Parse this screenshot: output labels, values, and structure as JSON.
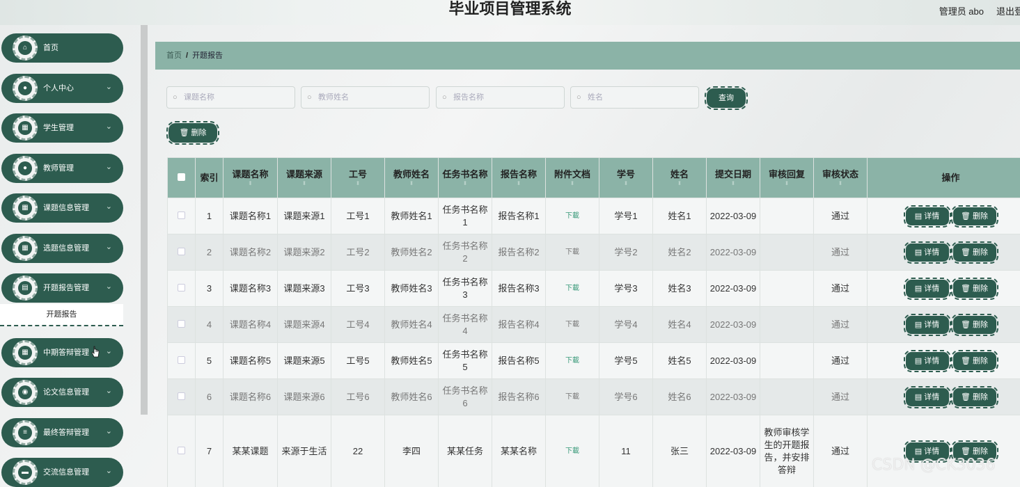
{
  "header": {
    "title": "毕业项目管理系统",
    "user": "管理员 abo",
    "logout": "退出登"
  },
  "sidebar": {
    "items": [
      {
        "label": "首页",
        "icon": "home-icon",
        "glyph": "⌂",
        "chevron": false
      },
      {
        "label": "个人中心",
        "icon": "user-icon",
        "glyph": "●",
        "chevron": true
      },
      {
        "label": "学生管理",
        "icon": "grid-icon",
        "glyph": "▦",
        "chevron": true
      },
      {
        "label": "教师管理",
        "icon": "user-icon",
        "glyph": "●",
        "chevron": true
      },
      {
        "label": "课题信息管理",
        "icon": "grid-icon",
        "glyph": "▦",
        "chevron": true
      },
      {
        "label": "选题信息管理",
        "icon": "grid-icon",
        "glyph": "▦",
        "chevron": true
      },
      {
        "label": "开题报告管理",
        "icon": "chart-icon",
        "glyph": "▤",
        "chevron": true
      },
      {
        "label": "中期答辩管理",
        "icon": "grid-icon",
        "glyph": "▦",
        "chevron": true
      },
      {
        "label": "论文信息管理",
        "icon": "bulb-icon",
        "glyph": "◉",
        "chevron": true
      },
      {
        "label": "最终答辩管理",
        "icon": "sliders-icon",
        "glyph": "≡",
        "chevron": true
      },
      {
        "label": "交流信息管理",
        "icon": "folder-icon",
        "glyph": "▬",
        "chevron": true
      }
    ],
    "active_submenu": "开题报告",
    "chevron_glyph": "⌄"
  },
  "breadcrumb": {
    "home": "首页",
    "separator": "/",
    "current": "开题报告"
  },
  "search": {
    "topic_placeholder": "课题名称",
    "teacher_placeholder": "教师姓名",
    "report_placeholder": "报告名称",
    "name_placeholder": "姓名",
    "query_label": "查询"
  },
  "toolbar": {
    "delete_label": "🗑 删除"
  },
  "table": {
    "headers": [
      "",
      "索引",
      "课题名称",
      "课题来源",
      "工号",
      "教师姓名",
      "任务书名称",
      "报告名称",
      "附件文档",
      "学号",
      "姓名",
      "提交日期",
      "审核回复",
      "审核状态",
      "操作"
    ],
    "rows": [
      {
        "index": "1",
        "topic": "课题名称1",
        "source": "课题来源1",
        "job_no": "工号1",
        "teacher": "教师姓名1",
        "task": "任务书名称1",
        "report": "报告名称1",
        "file": "下載",
        "student_no": "学号1",
        "name": "姓名1",
        "date": "2022-03-09",
        "reply": "",
        "status": "通过"
      },
      {
        "index": "2",
        "topic": "课题名称2",
        "source": "课题来源2",
        "job_no": "工号2",
        "teacher": "教师姓名2",
        "task": "任务书名称2",
        "report": "报告名称2",
        "file": "下載",
        "student_no": "学号2",
        "name": "姓名2",
        "date": "2022-03-09",
        "reply": "",
        "status": "通过"
      },
      {
        "index": "3",
        "topic": "课题名称3",
        "source": "课题来源3",
        "job_no": "工号3",
        "teacher": "教师姓名3",
        "task": "任务书名称3",
        "report": "报告名称3",
        "file": "下載",
        "student_no": "学号3",
        "name": "姓名3",
        "date": "2022-03-09",
        "reply": "",
        "status": "通过"
      },
      {
        "index": "4",
        "topic": "课题名称4",
        "source": "课题来源4",
        "job_no": "工号4",
        "teacher": "教师姓名4",
        "task": "任务书名称4",
        "report": "报告名称4",
        "file": "下載",
        "student_no": "学号4",
        "name": "姓名4",
        "date": "2022-03-09",
        "reply": "",
        "status": "通过"
      },
      {
        "index": "5",
        "topic": "课题名称5",
        "source": "课题来源5",
        "job_no": "工号5",
        "teacher": "教师姓名5",
        "task": "任务书名称5",
        "report": "报告名称5",
        "file": "下載",
        "student_no": "学号5",
        "name": "姓名5",
        "date": "2022-03-09",
        "reply": "",
        "status": "通过"
      },
      {
        "index": "6",
        "topic": "课题名称6",
        "source": "课题来源6",
        "job_no": "工号6",
        "teacher": "教师姓名6",
        "task": "任务书名称6",
        "report": "报告名称6",
        "file": "下載",
        "student_no": "学号6",
        "name": "姓名6",
        "date": "2022-03-09",
        "reply": "",
        "status": "通过"
      },
      {
        "index": "7",
        "topic": "某某课题",
        "source": "来源于生活",
        "job_no": "22",
        "teacher": "李四",
        "task": "某某任务",
        "report": "某某名称",
        "file": "下載",
        "student_no": "11",
        "name": "张三",
        "date": "2022-03-09",
        "reply": "教师审核学生的开题报告，并安排答辩",
        "status": "通过"
      }
    ],
    "detail_label": "▤ 详情",
    "delete_label": "🗑 删除"
  },
  "watermark": "CSDN @CK3036",
  "colors": {
    "primary": "#2d5c4f",
    "header_teal": "#8bb3a7",
    "link": "#3a9a7a"
  }
}
